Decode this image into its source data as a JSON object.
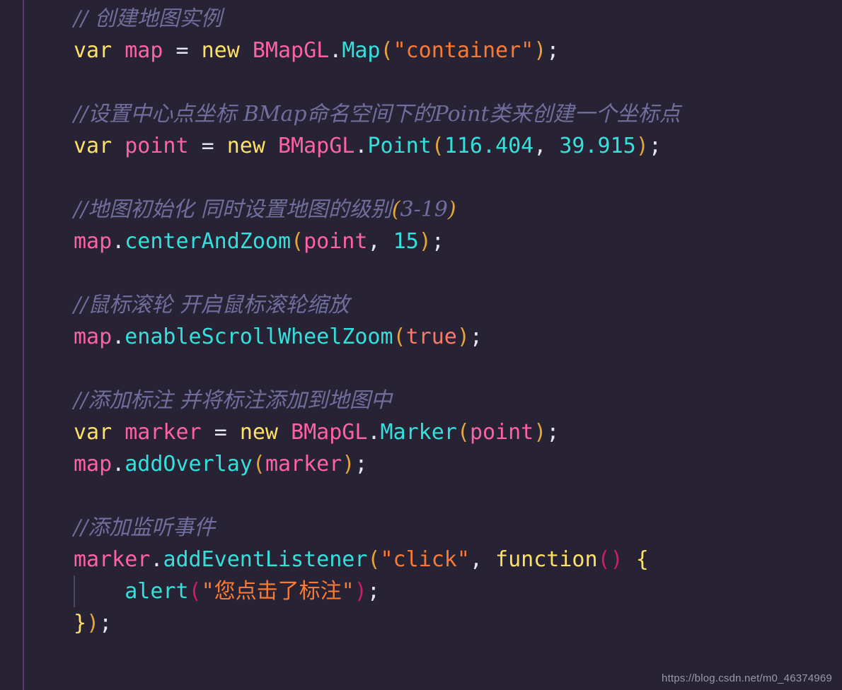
{
  "editor": {
    "background_color": "#272334",
    "ruler_color": "#5b3a71",
    "indent_guide_color": "#4b4760",
    "font_size_px": 30,
    "line_height_px": 45
  },
  "palette": {
    "comment": "#6f6e9c",
    "keyword": "#ffe066",
    "variable": "#fc62a5",
    "class_name": "#fc62a5",
    "property": "#34e0db",
    "function": "#34e0db",
    "string": "#f97a34",
    "number": "#34e0db",
    "boolean": "#f97a6b",
    "operator": "#e6e6f0",
    "punctuation": "#e6e6f0",
    "bracket_level_1": "#e6a53a",
    "bracket_level_2": "#d31a6a",
    "brace": "#ffe066"
  },
  "lines": [
    {
      "id": "line-1",
      "kind": "comment",
      "text": "// 创建地图实例",
      "tokens": [
        {
          "t": "// ",
          "c": "tok-comment"
        },
        {
          "t": "创建地图实例",
          "c": "tok-comment"
        }
      ]
    },
    {
      "id": "line-2",
      "kind": "code",
      "text": "var map = new BMapGL.Map(\"container\");",
      "tokens": [
        {
          "t": "var",
          "c": "tok-keyword"
        },
        {
          "t": " ",
          "c": "tok-punct"
        },
        {
          "t": "map",
          "c": "tok-variable"
        },
        {
          "t": " ",
          "c": "tok-punct"
        },
        {
          "t": "=",
          "c": "tok-operator"
        },
        {
          "t": " ",
          "c": "tok-punct"
        },
        {
          "t": "new",
          "c": "tok-keyword"
        },
        {
          "t": " ",
          "c": "tok-punct"
        },
        {
          "t": "BMapGL",
          "c": "tok-class"
        },
        {
          "t": ".",
          "c": "tok-dot"
        },
        {
          "t": "Map",
          "c": "tok-property"
        },
        {
          "t": "(",
          "c": "tok-paren-1"
        },
        {
          "t": "\"container\"",
          "c": "tok-string"
        },
        {
          "t": ")",
          "c": "tok-paren-1"
        },
        {
          "t": ";",
          "c": "tok-punct"
        }
      ]
    },
    {
      "id": "line-3",
      "kind": "blank",
      "text": "",
      "tokens": []
    },
    {
      "id": "line-4",
      "kind": "comment",
      "text": "//设置中心点坐标 BMap命名空间下的Point类来创建一个坐标点",
      "tokens": [
        {
          "t": "//设置中心点坐标 BMap命名空间下的Point类来创建一个坐标点",
          "c": "tok-comment"
        }
      ]
    },
    {
      "id": "line-5",
      "kind": "code",
      "text": "var point = new BMapGL.Point(116.404, 39.915);",
      "tokens": [
        {
          "t": "var",
          "c": "tok-keyword"
        },
        {
          "t": " ",
          "c": "tok-punct"
        },
        {
          "t": "point",
          "c": "tok-variable"
        },
        {
          "t": " ",
          "c": "tok-punct"
        },
        {
          "t": "=",
          "c": "tok-operator"
        },
        {
          "t": " ",
          "c": "tok-punct"
        },
        {
          "t": "new",
          "c": "tok-keyword"
        },
        {
          "t": " ",
          "c": "tok-punct"
        },
        {
          "t": "BMapGL",
          "c": "tok-class"
        },
        {
          "t": ".",
          "c": "tok-dot"
        },
        {
          "t": "Point",
          "c": "tok-property"
        },
        {
          "t": "(",
          "c": "tok-paren-1"
        },
        {
          "t": "116.404",
          "c": "tok-number"
        },
        {
          "t": ",",
          "c": "tok-punct"
        },
        {
          "t": " ",
          "c": "tok-punct"
        },
        {
          "t": "39.915",
          "c": "tok-number"
        },
        {
          "t": ")",
          "c": "tok-paren-1"
        },
        {
          "t": ";",
          "c": "tok-punct"
        }
      ]
    },
    {
      "id": "line-6",
      "kind": "blank",
      "text": "",
      "tokens": []
    },
    {
      "id": "line-7",
      "kind": "comment",
      "text": "//地图初始化 同时设置地图的级别(3-19)",
      "tokens": [
        {
          "t": "//地图初始化 同时设置地图的级别",
          "c": "tok-comment"
        },
        {
          "t": "(",
          "c": "tok-comment-paren"
        },
        {
          "t": "3-19",
          "c": "tok-comment"
        },
        {
          "t": ")",
          "c": "tok-comment-paren"
        }
      ]
    },
    {
      "id": "line-8",
      "kind": "code",
      "text": "map.centerAndZoom(point, 15);",
      "tokens": [
        {
          "t": "map",
          "c": "tok-variable"
        },
        {
          "t": ".",
          "c": "tok-dot"
        },
        {
          "t": "centerAndZoom",
          "c": "tok-function"
        },
        {
          "t": "(",
          "c": "tok-paren-1"
        },
        {
          "t": "point",
          "c": "tok-variable"
        },
        {
          "t": ",",
          "c": "tok-punct"
        },
        {
          "t": " ",
          "c": "tok-punct"
        },
        {
          "t": "15",
          "c": "tok-number"
        },
        {
          "t": ")",
          "c": "tok-paren-1"
        },
        {
          "t": ";",
          "c": "tok-punct"
        }
      ]
    },
    {
      "id": "line-9",
      "kind": "blank",
      "text": "",
      "tokens": []
    },
    {
      "id": "line-10",
      "kind": "comment",
      "text": "//鼠标滚轮 开启鼠标滚轮缩放",
      "tokens": [
        {
          "t": "//鼠标滚轮 开启鼠标滚轮缩放",
          "c": "tok-comment"
        }
      ]
    },
    {
      "id": "line-11",
      "kind": "code",
      "text": "map.enableScrollWheelZoom(true);",
      "tokens": [
        {
          "t": "map",
          "c": "tok-variable"
        },
        {
          "t": ".",
          "c": "tok-dot"
        },
        {
          "t": "enableScrollWheelZoom",
          "c": "tok-function"
        },
        {
          "t": "(",
          "c": "tok-paren-1"
        },
        {
          "t": "true",
          "c": "tok-boolean"
        },
        {
          "t": ")",
          "c": "tok-paren-1"
        },
        {
          "t": ";",
          "c": "tok-punct"
        }
      ]
    },
    {
      "id": "line-12",
      "kind": "blank",
      "text": "",
      "tokens": []
    },
    {
      "id": "line-13",
      "kind": "comment",
      "text": "//添加标注 并将标注添加到地图中",
      "tokens": [
        {
          "t": "//添加标注 并将标注添加到地图中",
          "c": "tok-comment"
        }
      ]
    },
    {
      "id": "line-14",
      "kind": "code",
      "text": "var marker = new BMapGL.Marker(point);",
      "tokens": [
        {
          "t": "var",
          "c": "tok-keyword"
        },
        {
          "t": " ",
          "c": "tok-punct"
        },
        {
          "t": "marker",
          "c": "tok-variable"
        },
        {
          "t": " ",
          "c": "tok-punct"
        },
        {
          "t": "=",
          "c": "tok-operator"
        },
        {
          "t": " ",
          "c": "tok-punct"
        },
        {
          "t": "new",
          "c": "tok-keyword"
        },
        {
          "t": " ",
          "c": "tok-punct"
        },
        {
          "t": "BMapGL",
          "c": "tok-class"
        },
        {
          "t": ".",
          "c": "tok-dot"
        },
        {
          "t": "Marker",
          "c": "tok-property"
        },
        {
          "t": "(",
          "c": "tok-paren-1"
        },
        {
          "t": "point",
          "c": "tok-variable"
        },
        {
          "t": ")",
          "c": "tok-paren-1"
        },
        {
          "t": ";",
          "c": "tok-punct"
        }
      ]
    },
    {
      "id": "line-15",
      "kind": "code",
      "text": "map.addOverlay(marker);",
      "tokens": [
        {
          "t": "map",
          "c": "tok-variable"
        },
        {
          "t": ".",
          "c": "tok-dot"
        },
        {
          "t": "addOverlay",
          "c": "tok-function"
        },
        {
          "t": "(",
          "c": "tok-paren-1"
        },
        {
          "t": "marker",
          "c": "tok-variable"
        },
        {
          "t": ")",
          "c": "tok-paren-1"
        },
        {
          "t": ";",
          "c": "tok-punct"
        }
      ]
    },
    {
      "id": "line-16",
      "kind": "blank",
      "text": "",
      "tokens": []
    },
    {
      "id": "line-17",
      "kind": "comment",
      "text": "//添加监听事件",
      "tokens": [
        {
          "t": "//添加监听事件",
          "c": "tok-comment"
        }
      ]
    },
    {
      "id": "line-18",
      "kind": "code",
      "text": "marker.addEventListener(\"click\", function() {",
      "tokens": [
        {
          "t": "marker",
          "c": "tok-variable"
        },
        {
          "t": ".",
          "c": "tok-dot"
        },
        {
          "t": "addEventListener",
          "c": "tok-function"
        },
        {
          "t": "(",
          "c": "tok-paren-1"
        },
        {
          "t": "\"click\"",
          "c": "tok-string"
        },
        {
          "t": ",",
          "c": "tok-punct"
        },
        {
          "t": " ",
          "c": "tok-punct"
        },
        {
          "t": "function",
          "c": "tok-keyword"
        },
        {
          "t": "(",
          "c": "tok-paren-2"
        },
        {
          "t": ")",
          "c": "tok-paren-2"
        },
        {
          "t": " ",
          "c": "tok-punct"
        },
        {
          "t": "{",
          "c": "tok-brace-1"
        }
      ]
    },
    {
      "id": "line-19",
      "kind": "code-indented",
      "text": "    alert(\"您点击了标注\");",
      "tokens": [
        {
          "t": "    ",
          "c": "tok-punct"
        },
        {
          "t": "alert",
          "c": "tok-function"
        },
        {
          "t": "(",
          "c": "tok-paren-2"
        },
        {
          "t": "\"您点击了标注\"",
          "c": "tok-string"
        },
        {
          "t": ")",
          "c": "tok-paren-2"
        },
        {
          "t": ";",
          "c": "tok-punct"
        }
      ]
    },
    {
      "id": "line-20",
      "kind": "code",
      "text": "});",
      "tokens": [
        {
          "t": "}",
          "c": "tok-brace-1"
        },
        {
          "t": ")",
          "c": "tok-paren-1"
        },
        {
          "t": ";",
          "c": "tok-punct"
        }
      ]
    }
  ],
  "watermark": {
    "text": "https://blog.csdn.net/m0_46374969"
  }
}
